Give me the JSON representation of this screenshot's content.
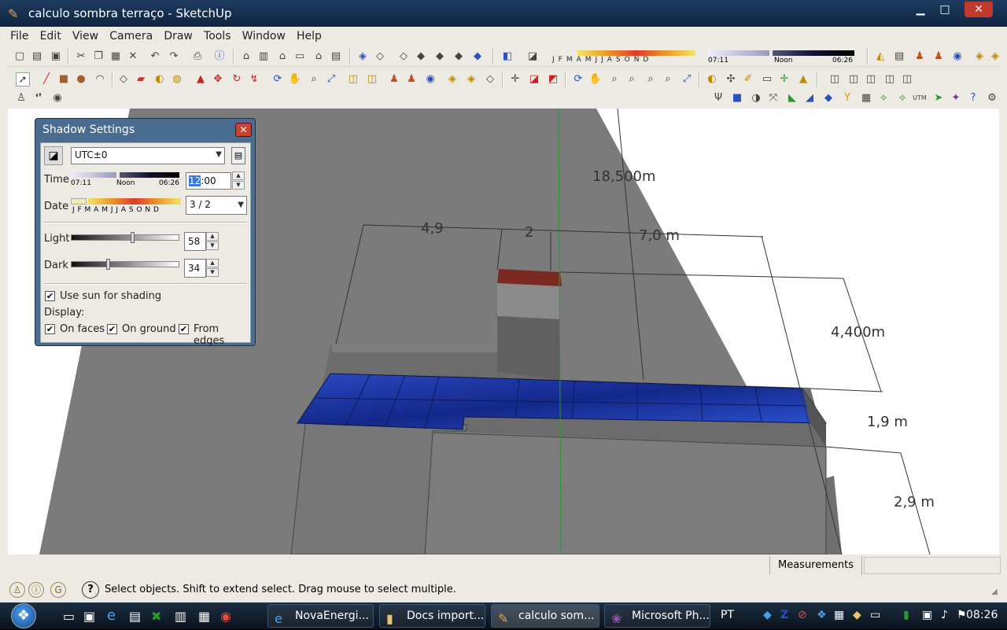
{
  "window": {
    "title": "calculo sombra terraço - SketchUp",
    "minimize": "▁",
    "maximize": "□",
    "close": "✕"
  },
  "menu": [
    "File",
    "Edit",
    "View",
    "Camera",
    "Draw",
    "Tools",
    "Window",
    "Help"
  ],
  "toolbar_shadow": {
    "months": [
      "J",
      "F",
      "M",
      "A",
      "M",
      "J",
      "J",
      "A",
      "S",
      "O",
      "N",
      "D"
    ],
    "time_start": "07:11",
    "time_noon": "Noon",
    "time_end": "06:26"
  },
  "dialog": {
    "title": "Shadow Settings",
    "close": "✕",
    "timezone": "UTC±0",
    "time_label": "Time",
    "time_start": "07:11",
    "time_noon": "Noon",
    "time_end": "06:26",
    "time_value_hour": "12",
    "time_value_rest": ":00",
    "date_label": "Date",
    "months": "J F M A M J J A S O N D",
    "date_value": "3 / 2",
    "light_label": "Light",
    "light_value": "58",
    "light_level": 0.58,
    "dark_label": "Dark",
    "dark_value": "34",
    "dark_level": 0.34,
    "use_sun_label": "Use sun for shading",
    "use_sun_checked": true,
    "display_label": "Display:",
    "on_faces_label": "On faces",
    "on_ground_label": "On ground",
    "from_edges_label": "From edges"
  },
  "dimensions": {
    "d1": "18,500m",
    "d2": "4,9",
    "d3": "2",
    "d4": "7,0 m",
    "d5": "4,400m",
    "d6": "1,9 m",
    "d7": "2,9 m"
  },
  "status": {
    "measurements_label": "Measurements",
    "help_text": "Select objects. Shift to extend select. Drag mouse to select multiple."
  },
  "taskbar": {
    "tasks": [
      "NovaEnergi...",
      "Docs import...",
      "calculo som...",
      "Microsoft Ph..."
    ],
    "lang": "PT",
    "clock": "08:26"
  },
  "colors": {
    "panel_blue": "#1f3aa8",
    "ground_gray": "#7d7d7d",
    "shadow_dark": "#6a6a6a",
    "axis_green": "#2a9a2a"
  }
}
